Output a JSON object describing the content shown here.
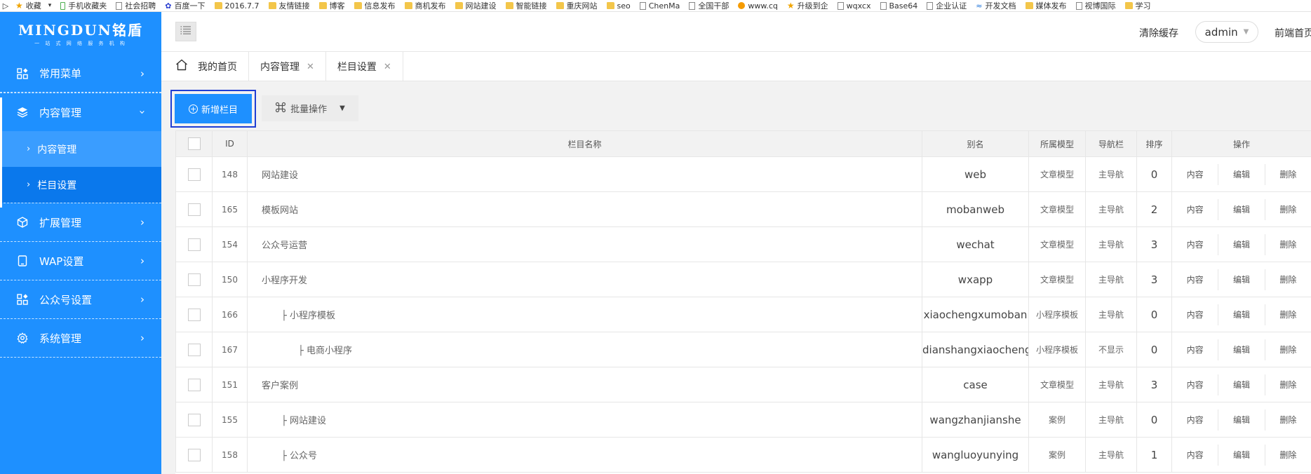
{
  "bookmarks": [
    {
      "label": "收藏",
      "icon": "star-icon"
    },
    {
      "label": "手机收藏夹",
      "icon": "phone-icon"
    },
    {
      "label": "社会招聘",
      "icon": "page-icon"
    },
    {
      "label": "百度一下",
      "icon": "paw-icon"
    },
    {
      "label": "2016.7.7",
      "icon": "folder-icon"
    },
    {
      "label": "友情链接",
      "icon": "folder-icon"
    },
    {
      "label": "博客",
      "icon": "folder-icon"
    },
    {
      "label": "信息发布",
      "icon": "folder-icon"
    },
    {
      "label": "商机发布",
      "icon": "folder-icon"
    },
    {
      "label": "网站建设",
      "icon": "folder-icon"
    },
    {
      "label": "智能链接",
      "icon": "folder-icon"
    },
    {
      "label": "重庆网站",
      "icon": "folder-icon"
    },
    {
      "label": "seo",
      "icon": "folder-icon"
    },
    {
      "label": "ChenMa",
      "icon": "page-icon"
    },
    {
      "label": "全国干部",
      "icon": "page-icon"
    },
    {
      "label": "www.cq",
      "icon": "sun-icon"
    },
    {
      "label": "升级到企",
      "icon": "star-icon"
    },
    {
      "label": "wqxcx",
      "icon": "page-icon"
    },
    {
      "label": "Base64",
      "icon": "page-icon"
    },
    {
      "label": "企业认证",
      "icon": "page-icon"
    },
    {
      "label": "开发文档",
      "icon": "wave-icon"
    },
    {
      "label": "媒体发布",
      "icon": "folder-icon"
    },
    {
      "label": "视博国际",
      "icon": "page-icon"
    },
    {
      "label": "学习",
      "icon": "folder-icon"
    }
  ],
  "logo": {
    "main": "MINGDUN铭盾",
    "sub": "一 站 式 网 络 服 务 机 构"
  },
  "sidebar": {
    "items": [
      {
        "label": "常用菜单",
        "icon": "grid-icon"
      },
      {
        "label": "内容管理",
        "icon": "layers-icon"
      },
      {
        "label": "扩展管理",
        "icon": "cube-icon"
      },
      {
        "label": "WAP设置",
        "icon": "tablet-icon"
      },
      {
        "label": "公众号设置",
        "icon": "grid-icon"
      },
      {
        "label": "系统管理",
        "icon": "gear-icon"
      }
    ],
    "submenu": [
      {
        "label": "内容管理"
      },
      {
        "label": "栏目设置"
      }
    ]
  },
  "header": {
    "clear_cache": "清除缓存",
    "user": "admin",
    "front_home": "前端首页"
  },
  "tabs": [
    {
      "label": "我的首页"
    },
    {
      "label": "内容管理"
    },
    {
      "label": "栏目设置"
    }
  ],
  "toolbar": {
    "add_label": "新增栏目",
    "batch_label": "批量操作"
  },
  "table": {
    "headers": {
      "id": "ID",
      "name": "栏目名称",
      "alias": "别名",
      "model": "所属模型",
      "nav": "导航栏",
      "sort": "排序",
      "ops": "操作"
    },
    "op_labels": {
      "content": "内容",
      "edit": "编辑",
      "delete": "删除"
    },
    "rows": [
      {
        "id": "148",
        "name": "网站建设",
        "alias": "web",
        "model": "文章模型",
        "nav": "主导航",
        "sort": "0"
      },
      {
        "id": "165",
        "name": "模板网站",
        "alias": "mobanweb",
        "model": "文章模型",
        "nav": "主导航",
        "sort": "2"
      },
      {
        "id": "154",
        "name": "公众号运营",
        "alias": "wechat",
        "model": "文章模型",
        "nav": "主导航",
        "sort": "3"
      },
      {
        "id": "150",
        "name": "小程序开发",
        "alias": "wxapp",
        "model": "文章模型",
        "nav": "主导航",
        "sort": "3"
      },
      {
        "id": "166",
        "name": "├ 小程序模板",
        "alias": "xiaochengxumoban",
        "model": "小程序模板",
        "nav": "主导航",
        "sort": "0"
      },
      {
        "id": "167",
        "name": "├ 电商小程序",
        "alias": "dianshangxiaochengxu",
        "model": "小程序模板",
        "nav": "不显示",
        "sort": "0"
      },
      {
        "id": "151",
        "name": "客户案例",
        "alias": "case",
        "model": "文章模型",
        "nav": "主导航",
        "sort": "3"
      },
      {
        "id": "155",
        "name": "├ 网站建设",
        "alias": "wangzhanjianshe",
        "model": "案例",
        "nav": "主导航",
        "sort": "0"
      },
      {
        "id": "158",
        "name": "├ 公众号",
        "alias": "wangluoyunying",
        "model": "案例",
        "nav": "主导航",
        "sort": "1"
      }
    ]
  },
  "colors": {
    "sidebar": "#1e90ff",
    "active_sub": "#0a78ec",
    "highlight_border": "#1f3ed4"
  }
}
